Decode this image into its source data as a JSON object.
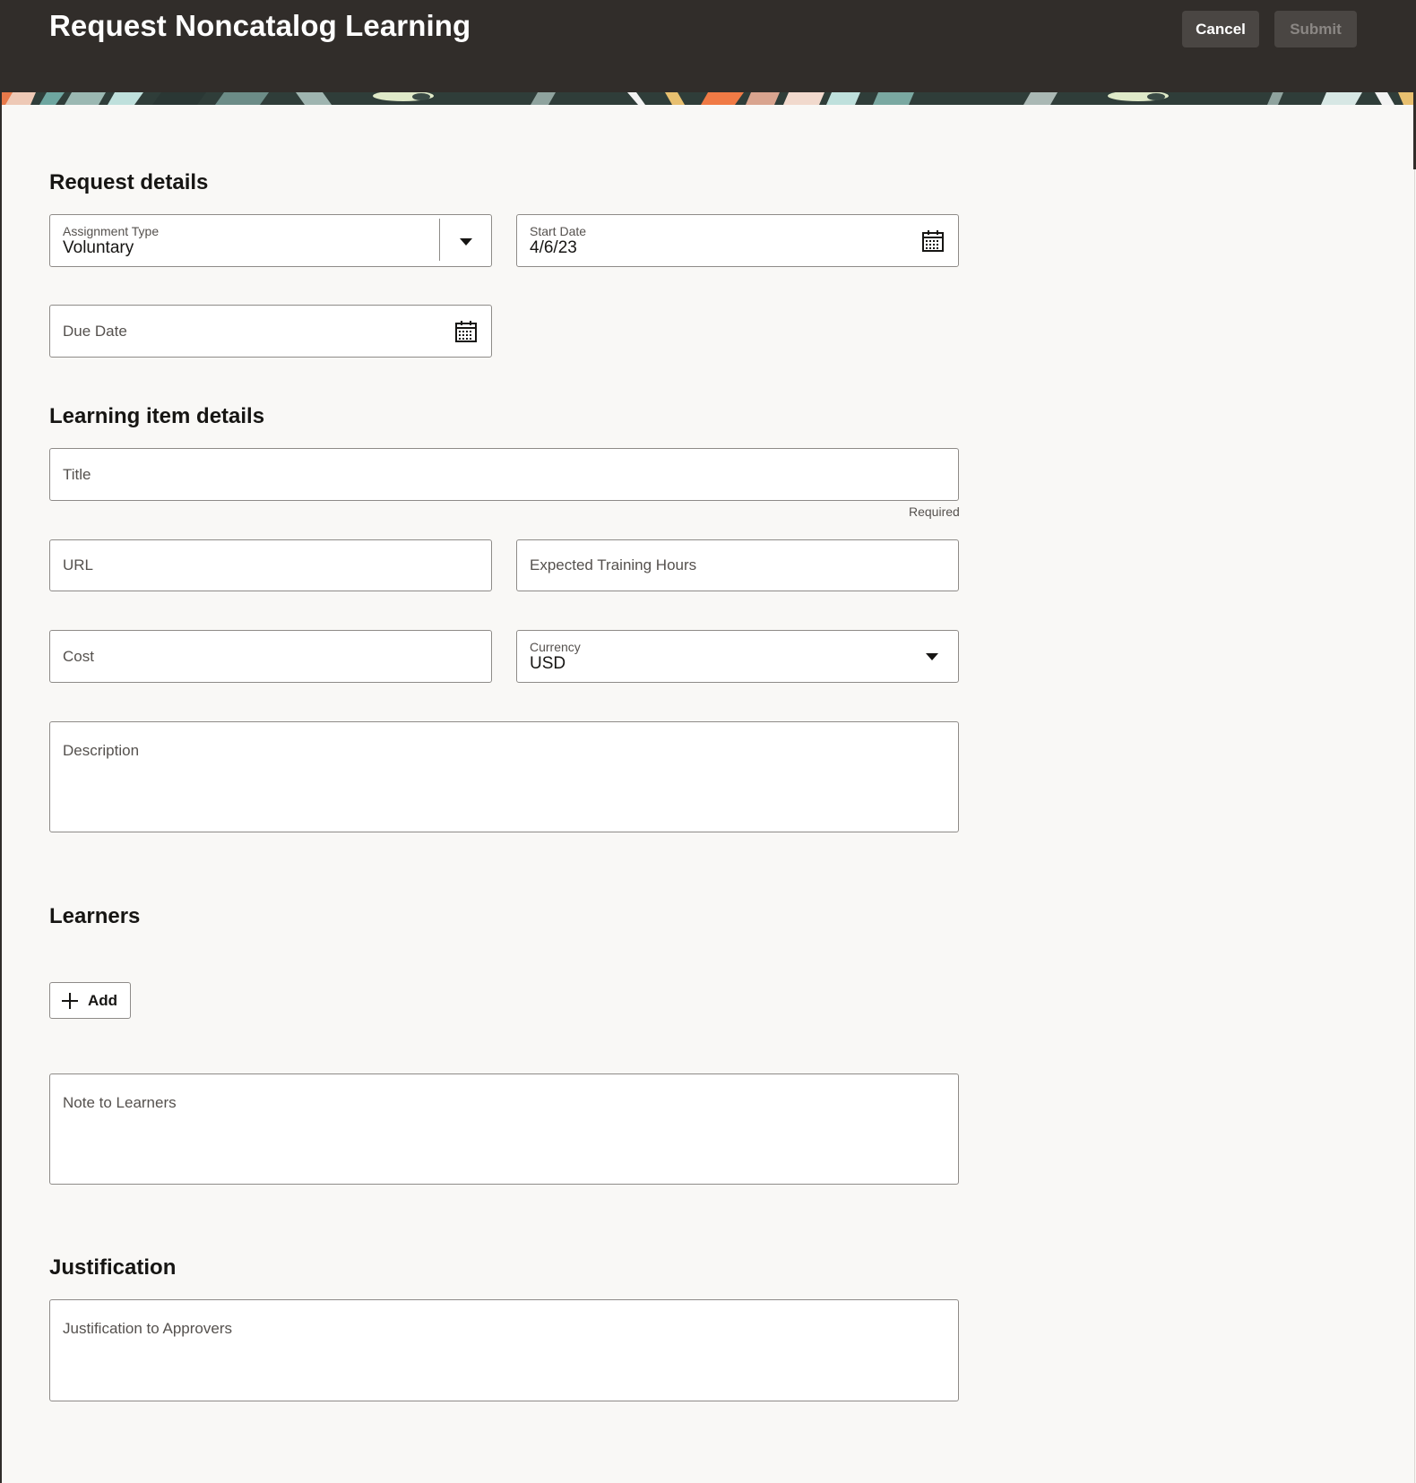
{
  "header": {
    "title": "Request Noncatalog Learning",
    "cancel_label": "Cancel",
    "submit_label": "Submit"
  },
  "request_details": {
    "section_title": "Request details",
    "assignment_type": {
      "label": "Assignment Type",
      "value": "Voluntary"
    },
    "start_date": {
      "label": "Start Date",
      "value": "4/6/23"
    },
    "due_date": {
      "label": "Due Date"
    }
  },
  "learning_item": {
    "section_title": "Learning item details",
    "title": {
      "label": "Title",
      "helper": "Required"
    },
    "url": {
      "label": "URL"
    },
    "expected_hours": {
      "label": "Expected Training Hours"
    },
    "cost": {
      "label": "Cost"
    },
    "currency": {
      "label": "Currency",
      "value": "USD"
    },
    "description": {
      "label": "Description"
    }
  },
  "learners": {
    "section_title": "Learners",
    "add_label": "Add",
    "note": {
      "label": "Note to Learners"
    }
  },
  "justification": {
    "section_title": "Justification",
    "field": {
      "label": "Justification to Approvers"
    }
  },
  "icons": {
    "calendar": "calendar-icon",
    "dropdown": "chevron-down-icon",
    "add": "plus-icon"
  }
}
